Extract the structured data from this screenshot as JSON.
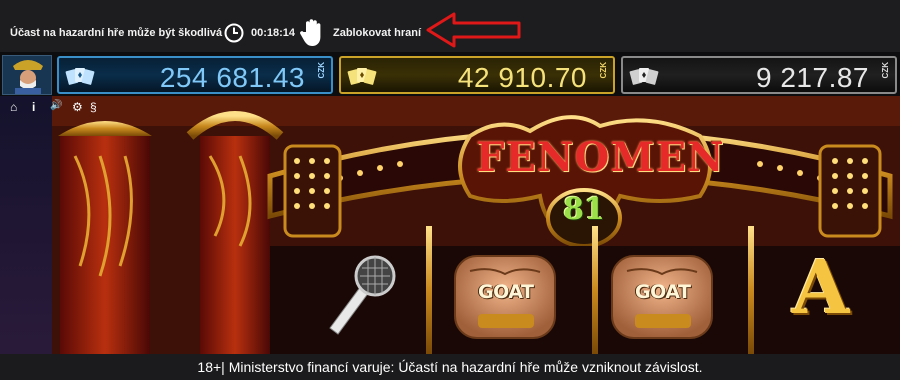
{
  "top_bar": {
    "warning": "Účast na hazardní hře může být škodlivá",
    "session_timer": "00:18:14",
    "block_link": "Zablokovat hraní",
    "icons": [
      "clock-icon",
      "hand-stop-icon",
      "red-arrow-icon"
    ]
  },
  "jackpots": [
    {
      "value": "254 681.43",
      "currency": "CZK",
      "tier_color": "#3a8fc9"
    },
    {
      "value": "42 910.70",
      "currency": "CZK",
      "tier_color": "#c9a227"
    },
    {
      "value": "9 217.87",
      "currency": "CZK",
      "tier_color": "#8a8a8a"
    }
  ],
  "toolbar": {
    "icons": [
      "home-icon",
      "info-icon",
      "sound-icon",
      "settings-icon",
      "paragraph-icon"
    ],
    "home": "⌂",
    "info": "i",
    "sound": "🔊",
    "settings": "⚙",
    "rules": "§"
  },
  "game": {
    "logo_title": "FENOMEN",
    "logo_number": "81",
    "symbols": [
      "microphone",
      "GOAT",
      "GOAT",
      "A"
    ],
    "goat_label": "GOAT",
    "a_label": "A"
  },
  "footer": {
    "text": "18+| Ministerstvo financí varuje: Účastí na hazardní hře může vzniknout závislost."
  },
  "colors": {
    "accent_red": "#e62a2a",
    "jackpot_blue": "#7fc8f7",
    "jackpot_gold": "#f6e27a",
    "jackpot_silver": "#e8e8e8"
  }
}
